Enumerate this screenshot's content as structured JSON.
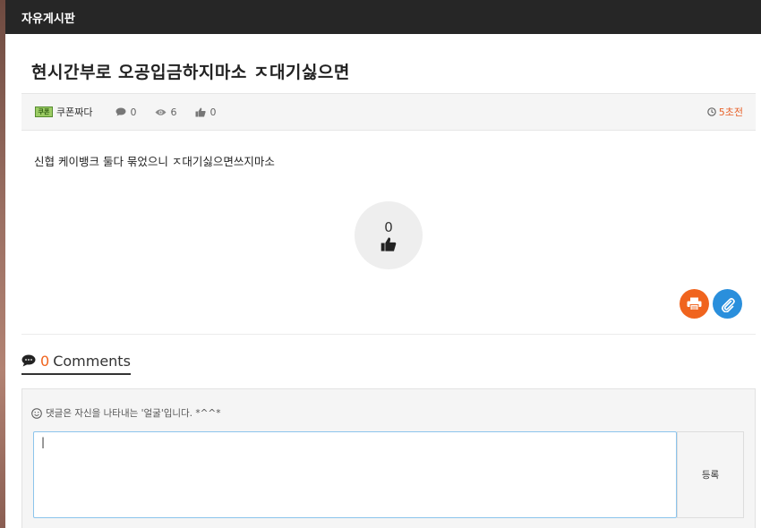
{
  "board": {
    "title": "자유게시판"
  },
  "post": {
    "title": "현시간부로 오공입금하지마소 ㅈ대기싫으면",
    "author": "쿠폰짜다",
    "author_badge": "쿠폰",
    "comment_count": "0",
    "view_count": "6",
    "like_count": "0",
    "time": "5초전",
    "body": "신협 케이뱅크 둘다 묶었으니 ㅈ대기싫으면쓰지마소",
    "recommend_count": "0"
  },
  "comments": {
    "count": "0",
    "label": "Comments",
    "notice": "댓글은 자신을 나타내는 '얼굴'입니다. *^^*",
    "input_value": "|",
    "submit_label": "등록"
  },
  "colors": {
    "header_bg": "#262626",
    "accent_orange": "#f0641e",
    "accent_blue": "#2a8fdc"
  },
  "icons": [
    "comment-icon",
    "eye-icon",
    "thumbs-up-icon",
    "clock-icon",
    "print-icon",
    "paperclip-icon",
    "smile-icon"
  ]
}
